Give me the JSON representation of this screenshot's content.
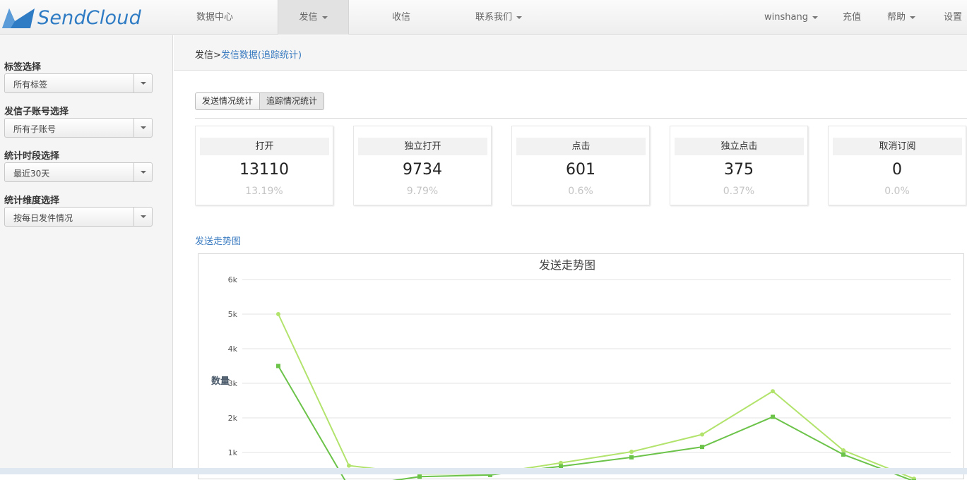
{
  "brand": {
    "name": "SendCloud",
    "color": "#2f7cc4"
  },
  "nav": {
    "items": [
      {
        "label": "数据中心"
      },
      {
        "label": "发信",
        "dropdown": true,
        "active": true
      },
      {
        "label": "收信"
      },
      {
        "label": "联系我们",
        "dropdown": true
      }
    ],
    "right": [
      {
        "label": "winshang",
        "dropdown": true
      },
      {
        "label": "充值"
      },
      {
        "label": "帮助",
        "dropdown": true
      },
      {
        "label": "设置",
        "dropdown": true
      }
    ]
  },
  "sidebar": {
    "filters": [
      {
        "label": "标签选择",
        "value": "所有标签"
      },
      {
        "label": "发信子账号选择",
        "value": "所有子账号"
      },
      {
        "label": "统计时段选择",
        "value": "最近30天"
      },
      {
        "label": "统计维度选择",
        "value": "按每日发件情况"
      }
    ]
  },
  "breadcrumb": {
    "root": "发信",
    "sep": ">",
    "current": "发信数据(追踪统计)"
  },
  "tabs": [
    {
      "label": "发送情况统计",
      "active": false
    },
    {
      "label": "追踪情况统计",
      "active": true
    }
  ],
  "stats": [
    {
      "label": "打开",
      "value": "13110",
      "percent": "13.19%"
    },
    {
      "label": "独立打开",
      "value": "9734",
      "percent": "9.79%"
    },
    {
      "label": "点击",
      "value": "601",
      "percent": "0.6%"
    },
    {
      "label": "独立点击",
      "value": "375",
      "percent": "0.37%"
    },
    {
      "label": "取消订阅",
      "value": "0",
      "percent": "0.0%"
    }
  ],
  "section_title": "发送走势图",
  "chart_data": {
    "type": "line",
    "title": "发送走势图",
    "ylabel": "数量",
    "ylim": [
      0,
      6000
    ],
    "yticks": [
      "1k",
      "2k",
      "3k",
      "4k",
      "5k",
      "6k"
    ],
    "grid": true,
    "x": [
      1,
      2,
      3,
      4,
      5,
      6,
      7,
      8,
      9,
      10
    ],
    "series": [
      {
        "color": "#b2e36c",
        "marker": "circle",
        "values": [
          5000,
          620,
          380,
          380,
          700,
          1020,
          1520,
          2770,
          1060,
          240
        ]
      },
      {
        "color": "#6cc34a",
        "marker": "square",
        "values": [
          3500,
          0,
          300,
          350,
          600,
          860,
          1160,
          2030,
          940,
          170
        ]
      }
    ]
  }
}
